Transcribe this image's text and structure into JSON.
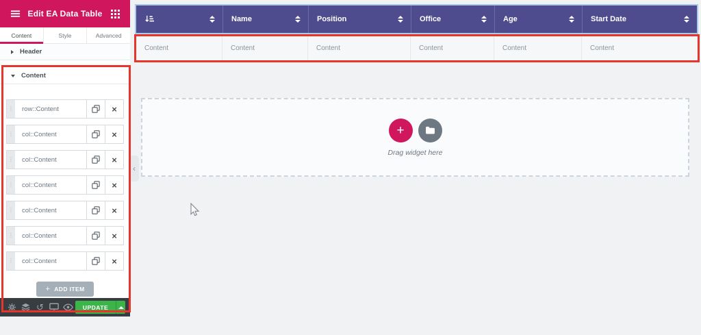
{
  "panel": {
    "title": "Edit EA Data Table",
    "tabs": [
      {
        "label": "Content",
        "active": true
      },
      {
        "label": "Style",
        "active": false
      },
      {
        "label": "Advanced",
        "active": false
      }
    ],
    "sections": {
      "header_label": "Header",
      "content_label": "Content"
    },
    "repeater_items": [
      {
        "label": "row::Content"
      },
      {
        "label": "col::Content"
      },
      {
        "label": "col::Content"
      },
      {
        "label": "col::Content"
      },
      {
        "label": "col::Content"
      },
      {
        "label": "col::Content"
      },
      {
        "label": "col::Content"
      }
    ],
    "add_item_label": "ADD ITEM",
    "footer": {
      "update_label": "UPDATE"
    }
  },
  "canvas": {
    "table": {
      "columns": [
        {
          "label": ""
        },
        {
          "label": "Name"
        },
        {
          "label": "Position"
        },
        {
          "label": "Office"
        },
        {
          "label": "Age"
        },
        {
          "label": "Start Date"
        }
      ],
      "row": [
        "Content",
        "Content",
        "Content",
        "Content",
        "Content",
        "Content"
      ]
    },
    "drop_area": {
      "hint": "Drag widget here"
    }
  },
  "icons": {
    "close": "×",
    "plus": "+",
    "collapse": "‹",
    "drag_handle": "⋮",
    "history": "↺"
  },
  "colors": {
    "accent_pink": "#d0175e",
    "header_purple": "#4e4c8e",
    "update_green": "#3bb54a",
    "annotation_red": "#e6352b",
    "selection_outline": "#a9cbe9"
  }
}
